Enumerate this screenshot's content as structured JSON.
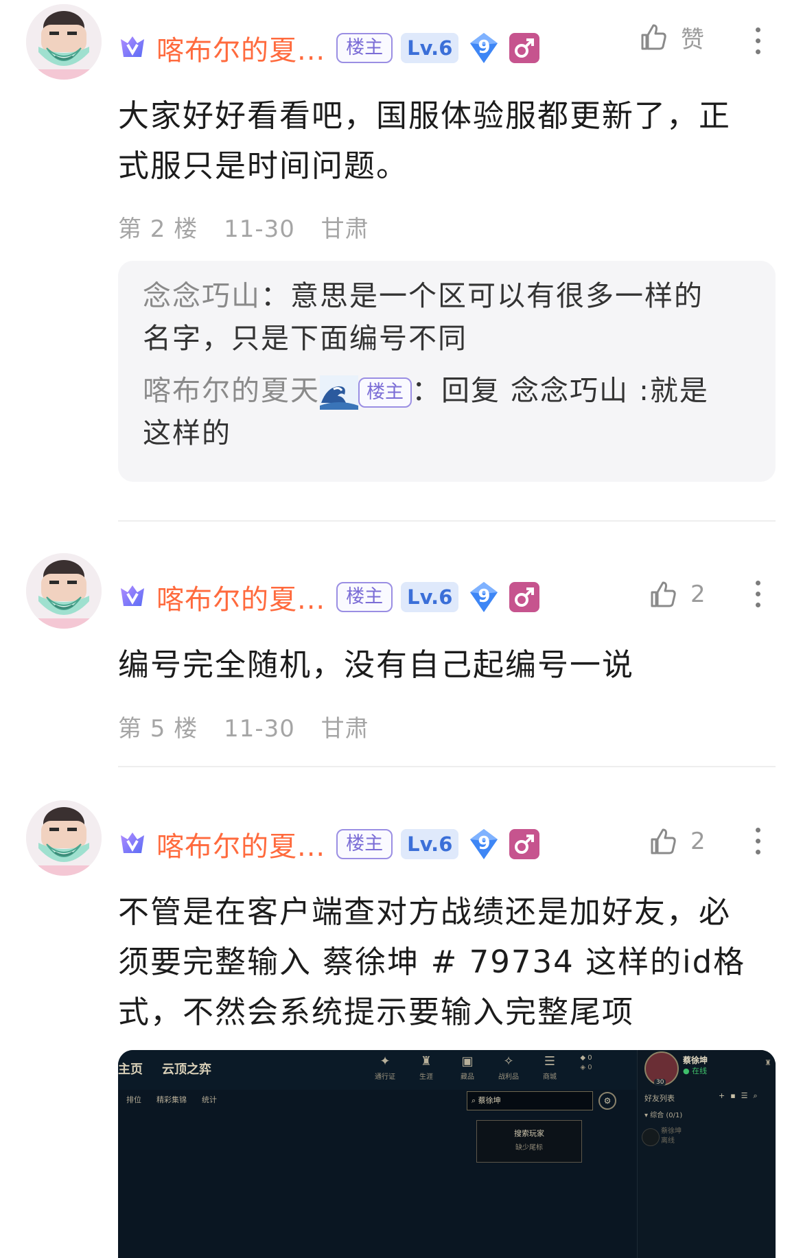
{
  "posts": [
    {
      "username": "喀布尔的夏...",
      "op_badge": "楼主",
      "level": "Lv.6",
      "gem_level": "9",
      "like_label": "赞",
      "content_line1": "大家好好看看吧，国服体验服都更新了，正",
      "content_line2": "式服只是时间问题。",
      "floor": "第 2 楼",
      "date": "11-30",
      "location": "甘肃",
      "replies": {
        "reply1_name": "念念巧山",
        "reply1_line1": "：意思是一个区可以有很多一样的",
        "reply1_line2": "名字，只是下面编号不同",
        "reply2_name": "喀布尔的夏天",
        "reply2_badge": "楼主",
        "reply2_text": "：回复 念念巧山 :就是",
        "reply2_line2": "这样的"
      }
    },
    {
      "username": "喀布尔的夏...",
      "op_badge": "楼主",
      "level": "Lv.6",
      "gem_level": "9",
      "like_count": "2",
      "content_line1": "编号完全随机，没有自己起编号一说",
      "floor": "第 5 楼",
      "date": "11-30",
      "location": "甘肃"
    },
    {
      "username": "喀布尔的夏...",
      "op_badge": "楼主",
      "level": "Lv.6",
      "gem_level": "9",
      "like_count": "2",
      "content_line1": "不管是在客户端查对方战绩还是加好友，必",
      "content_line2": "须要完整输入 蔡徐坤 # 79734 这样的id格",
      "content_line3": "式，不然会系统提示要输入完整尾项"
    }
  ],
  "screenshot": {
    "tab_home": "主页",
    "tab_tft": "云顶之弈",
    "sub_rank": "排位",
    "sub_highlights": "精彩集锦",
    "sub_stats": "统计",
    "icon_pass": "通行证",
    "icon_career": "生涯",
    "icon_collection": "藏品",
    "icon_loot": "战利品",
    "icon_store": "商城",
    "currency1": "0",
    "currency2": "0",
    "search_value": "蔡徐坤",
    "tip_title": "搜索玩家",
    "tip_sub": "缺少尾标",
    "player_name": "蔡徐坤",
    "player_status": "在线",
    "player_level": "30",
    "friends_list": "好友列表",
    "group_label": "综合 (0/1)",
    "friend_name": "蔡徐坤",
    "friend_status": "离线"
  },
  "colors": {
    "username": "#ff6a3d",
    "op_badge": "#7b6dd6",
    "level_badge": "#3b6fd8",
    "gem": "#3e86f5",
    "gender": "#c6548e",
    "meta": "#a5a5a5"
  }
}
